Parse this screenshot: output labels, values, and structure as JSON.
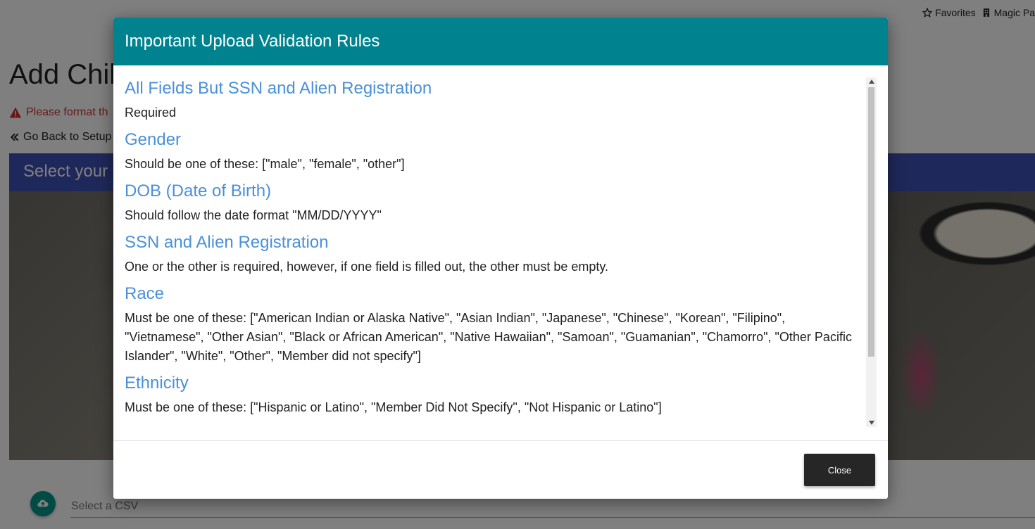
{
  "topnav": {
    "favorites_label": "Favorites",
    "magic_label": "Magic Pa"
  },
  "page": {
    "title": "Add Chil",
    "warning_text": "Please format th",
    "back_link": "Go Back to Setup",
    "card_header": "Select your C",
    "csv_placeholder": "Select a CSV"
  },
  "modal": {
    "title": "Important Upload Validation Rules",
    "rules": [
      {
        "title": "All Fields But SSN and Alien Registration",
        "desc": "Required"
      },
      {
        "title": "Gender",
        "desc": "Should be one of these: [\"male\", \"female\", \"other\"]"
      },
      {
        "title": "DOB (Date of Birth)",
        "desc": "Should follow the date format \"MM/DD/YYYY\""
      },
      {
        "title": "SSN and Alien Registration",
        "desc": "One or the other is required, however, if one field is filled out, the other must be empty."
      },
      {
        "title": "Race",
        "desc": "Must be one of these: [\"American Indian or Alaska Native\", \"Asian Indian\", \"Japanese\", \"Chinese\", \"Korean\", \"Filipino\", \"Vietnamese\", \"Other Asian\", \"Black or African American\", \"Native Hawaiian\", \"Samoan\", \"Guamanian\", \"Chamorro\", \"Other Pacific Islander\", \"White\", \"Other\", \"Member did not specify\"]"
      },
      {
        "title": "Ethnicity",
        "desc": "Must be one of these: [\"Hispanic or Latino\", \"Member Did Not Specify\", \"Not Hispanic or Latino\"]"
      }
    ],
    "close_label": "Close"
  },
  "colors": {
    "modal_header": "#00838f",
    "rule_title": "#4a90d9",
    "warning": "#d32f2f",
    "card_header": "#3f51b5",
    "fab": "#009688",
    "close_button": "#262626"
  },
  "icons": [
    "star-icon",
    "building-icon",
    "warning-icon",
    "double-chevron-left-icon",
    "cloud-upload-icon",
    "scroll-up-arrow-icon",
    "scroll-down-arrow-icon"
  ]
}
